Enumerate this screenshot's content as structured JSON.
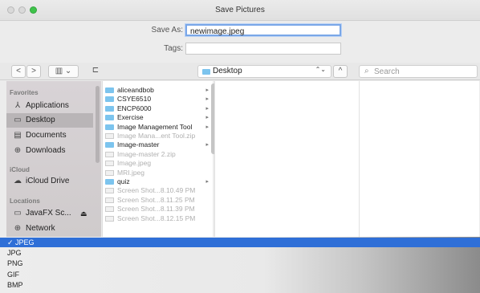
{
  "window": {
    "title": "Save Pictures"
  },
  "form": {
    "save_as_label": "Save As:",
    "save_as_value": "newimage.jpeg",
    "tags_label": "Tags:",
    "tags_value": ""
  },
  "toolbar": {
    "back": "<",
    "forward": ">",
    "view": "▥",
    "view_chevron": "⌄",
    "new_folder": "⊏",
    "location": "Desktop",
    "location_stepper": "⌃⌄",
    "expand": "^",
    "search_placeholder": "Search"
  },
  "sidebar": {
    "favorites_header": "Favorites",
    "favorites": [
      {
        "label": "Applications",
        "icon": "applications-icon",
        "glyph": "⅄"
      },
      {
        "label": "Desktop",
        "icon": "desktop-icon",
        "glyph": "▭"
      },
      {
        "label": "Documents",
        "icon": "documents-icon",
        "glyph": "▤"
      },
      {
        "label": "Downloads",
        "icon": "downloads-icon",
        "glyph": "⊕"
      }
    ],
    "icloud_header": "iCloud",
    "icloud": [
      {
        "label": "iCloud Drive",
        "icon": "cloud-icon",
        "glyph": "☁"
      }
    ],
    "locations_header": "Locations",
    "locations": [
      {
        "label": "JavaFX Sc...",
        "icon": "disk-icon",
        "glyph": "▭",
        "eject": "⏏"
      },
      {
        "label": "Network",
        "icon": "network-icon",
        "glyph": "⊕"
      }
    ]
  },
  "files": [
    {
      "name": "aliceandbob",
      "type": "folder",
      "dim": false,
      "arrow": "▸"
    },
    {
      "name": "CSYE6510",
      "type": "folder",
      "dim": false,
      "arrow": "▸"
    },
    {
      "name": "ENCP6000",
      "type": "folder",
      "dim": false,
      "arrow": "▸"
    },
    {
      "name": "Exercise",
      "type": "folder",
      "dim": false,
      "arrow": "▸"
    },
    {
      "name": "Image Management Tool",
      "type": "folder",
      "dim": false,
      "arrow": "▸"
    },
    {
      "name": "Image Mana...ent Tool.zip",
      "type": "file",
      "dim": true,
      "arrow": ""
    },
    {
      "name": "Image-master",
      "type": "folder",
      "dim": false,
      "arrow": "▸"
    },
    {
      "name": "Image-master 2.zip",
      "type": "file",
      "dim": true,
      "arrow": ""
    },
    {
      "name": "Image.jpeg",
      "type": "file",
      "dim": true,
      "arrow": ""
    },
    {
      "name": "MRI.jpeg",
      "type": "file",
      "dim": true,
      "arrow": ""
    },
    {
      "name": "quiz",
      "type": "folder",
      "dim": false,
      "arrow": "▸"
    },
    {
      "name": "Screen Shot...8.10.49 PM",
      "type": "file",
      "dim": true,
      "arrow": ""
    },
    {
      "name": "Screen Shot...8.11.25 PM",
      "type": "file",
      "dim": true,
      "arrow": ""
    },
    {
      "name": "Screen Shot...8.11.39 PM",
      "type": "file",
      "dim": true,
      "arrow": ""
    },
    {
      "name": "Screen Shot...8.12.15 PM",
      "type": "file",
      "dim": true,
      "arrow": ""
    }
  ],
  "format_menu": {
    "options": [
      "✓ JPEG",
      "JPG",
      "PNG",
      "GIF",
      "BMP"
    ],
    "selected_index": 0
  },
  "colors": {
    "accent": "#2f6fd7",
    "folder": "#7cc4ee",
    "green_button": "#3ec34a"
  }
}
